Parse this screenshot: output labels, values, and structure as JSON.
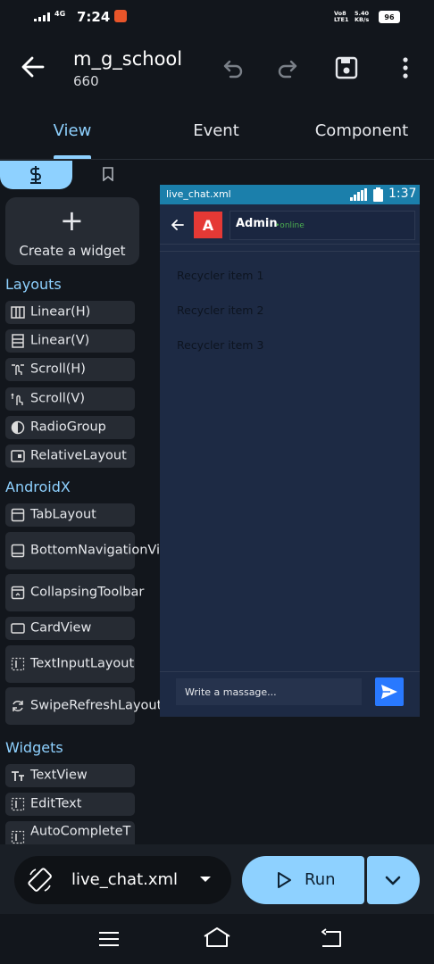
{
  "status_bar": {
    "time": "7:24",
    "network": "4G",
    "volte": "Vo8 LTE1",
    "speed": "5.40 KB/s",
    "battery": "96"
  },
  "header": {
    "title": "m_g_school",
    "subtitle": "660"
  },
  "tabs": [
    {
      "label": "View",
      "active": true
    },
    {
      "label": "Event"
    },
    {
      "label": "Component"
    }
  ],
  "palette": {
    "create_label": "Create a widget",
    "sections": [
      {
        "title": "Layouts",
        "items": [
          "Linear(H)",
          "Linear(V)",
          "Scroll(H)",
          "Scroll(V)",
          "RadioGroup",
          "RelativeLayout"
        ]
      },
      {
        "title": "AndroidX",
        "items": [
          "TabLayout",
          "BottomNavigationView",
          "CollapsingToolbar",
          "CardView",
          "TextInputLayout",
          "SwipeRefreshLayout"
        ]
      },
      {
        "title": "Widgets",
        "items": [
          "TextView",
          "EditText",
          "AutoCompleteT"
        ]
      }
    ]
  },
  "preview": {
    "file": "live_chat.xml",
    "time": "1:37",
    "avatar_letter": "A",
    "name": "Admin",
    "status": "•online",
    "recycler_items": [
      "Recycler item 1",
      "Recycler item 2",
      "Recycler item 3"
    ],
    "input_placeholder": "Write a massage..."
  },
  "bottom_bar": {
    "file_name": "live_chat.xml",
    "run_label": "Run"
  },
  "colors": {
    "accent": "#8ed1ff",
    "preview_status": "#1b7fab",
    "avatar": "#e53935",
    "send": "#2979ff"
  }
}
